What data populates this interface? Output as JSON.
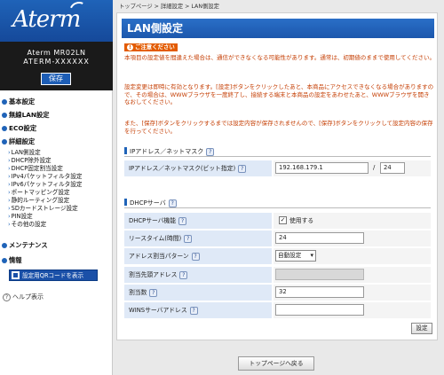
{
  "brand": {
    "logo": "Aterm",
    "model_name": "Aterm MR02LN",
    "model_id": "ATERM-XXXXXX",
    "save_label": "保存"
  },
  "nav": {
    "basic": "基本設定",
    "wireless_lan": "無線LAN設定",
    "eco": "ECO設定",
    "detail": "詳細設定",
    "detail_items": [
      "LAN側設定",
      "DHCP除外設定",
      "DHCP固定割当設定",
      "IPv4パケットフィルタ設定",
      "IPv6パケットフィルタ設定",
      "ポートマッピング設定",
      "静的ルーティング設定",
      "SDカードストレージ設定",
      "PIN設定",
      "その他の設定"
    ],
    "maintenance": "メンテナンス",
    "info": "情報",
    "qr_button": "設定用QRコードを表示",
    "help": "ヘルプ表示"
  },
  "breadcrumb": "トップページ > 詳細設定 > LAN側設定",
  "page_title": "LAN側設定",
  "caution": {
    "badge": "ご注意ください",
    "para1": "本項目の設定値を間違えた場合は、通信ができなくなる可能性があります。通常は、初期値のままで使用してください。",
    "para2": "設定変更は即時に有効となります。[設定]ボタンをクリックしたあと、本商品にアクセスできなくなる場合がありますので、その場合は、WWWブラウザを一度終了し、接続する端末と本商品の設定をあわせたあと、WWWブラウザを開きなおしてください。",
    "para3": "また、[保存]ボタンをクリックするまでは設定内容が保存されませんので、[保存]ボタンをクリックして設定内容の保存を行ってください。"
  },
  "ip_section": {
    "title": "IPアドレス／ネットマスク",
    "help": "?",
    "label": "IPアドレス／ネットマスク(ビット指定)",
    "ip_value": "192.168.179.1",
    "separator": "/",
    "mask_value": "24"
  },
  "dhcp_section": {
    "title": "DHCPサーバ",
    "help": "?",
    "rows": {
      "server_func": {
        "label": "DHCPサーバ機能",
        "checked": "✓",
        "check_label": "使用する"
      },
      "lease": {
        "label": "リースタイム(時間)",
        "value": "24"
      },
      "pattern": {
        "label": "アドレス割当パターン",
        "value": "自動設定"
      },
      "start": {
        "label": "割当先頭アドレス",
        "value": ""
      },
      "count": {
        "label": "割当数",
        "value": "32"
      },
      "wins": {
        "label": "WINSサーバアドレス",
        "value": ""
      }
    }
  },
  "buttons": {
    "setting": "設定",
    "to_top": "トップページへ戻る"
  }
}
